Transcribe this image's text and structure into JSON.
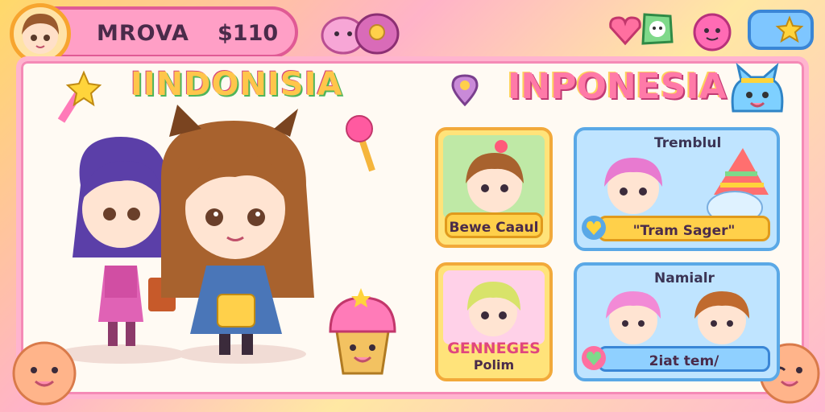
{
  "player": {
    "name": "MROVA",
    "money": "$110"
  },
  "titles": {
    "left": "IINDONISIA",
    "right": "INPONESIA"
  },
  "cards": [
    {
      "label": "Bewe Caaul"
    },
    {
      "top_label": "Tremblul",
      "label": "\"Tram Sager\""
    },
    {
      "title": "GENNEGES",
      "label": "Polim"
    },
    {
      "top_label": "Namialr",
      "label": "2iat tem/"
    }
  ],
  "icons": [
    "heart-gem-icon",
    "ghost-badge-icon",
    "pink-blob-icon",
    "star-icon",
    "location-pin-icon",
    "cat-mascot-icon"
  ],
  "colors": {
    "accent": "#ff7aa8",
    "panel_border": "#ffb4cf",
    "button_blue": "#7ec6ff"
  }
}
